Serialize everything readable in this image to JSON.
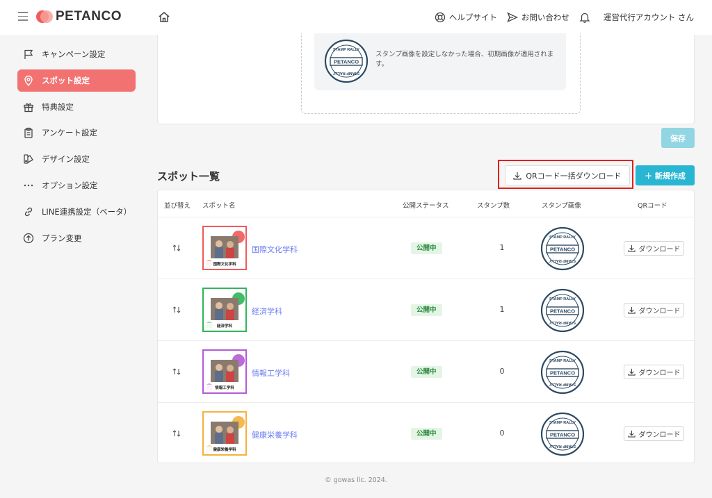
{
  "header": {
    "logo_text": "PETANCO",
    "help_label": "ヘルプサイト",
    "contact_label": "お問い合わせ",
    "account_label": "運営代行アカウント さん"
  },
  "sidebar": {
    "items": [
      {
        "label": "キャンペーン設定",
        "icon": "flag-icon",
        "active": false
      },
      {
        "label": "スポット設定",
        "icon": "map-pin-icon",
        "active": true
      },
      {
        "label": "特典設定",
        "icon": "gift-icon",
        "active": false
      },
      {
        "label": "アンケート設定",
        "icon": "clipboard-icon",
        "active": false
      },
      {
        "label": "デザイン設定",
        "icon": "palette-icon",
        "active": false
      },
      {
        "label": "オプション設定",
        "icon": "more-icon",
        "active": false
      },
      {
        "label": "LINE連携設定（ベータ）",
        "icon": "link-icon",
        "active": false
      },
      {
        "label": "プラン変更",
        "icon": "arrow-up-circle-icon",
        "active": false
      }
    ]
  },
  "stamp_image": {
    "note": "スタンプ画像を設定しなかった場合、初期画像が適用されます。",
    "stamp_text_top": "STAMP RALLY",
    "stamp_text_center": "PETANCO"
  },
  "save_label": "保存",
  "spot_list": {
    "title": "スポット一覧",
    "bulk_qr_label": "QRコード一括ダウンロード",
    "new_label": "＋ 新規作成",
    "columns": {
      "sort": "並び替え",
      "name": "スポット名",
      "status": "公開ステータス",
      "stamps": "スタンプ数",
      "stamp_image": "スタンプ画像",
      "qr": "QRコード"
    },
    "rows": [
      {
        "name": "国際文化学科",
        "status": "公開中",
        "stamps": "1",
        "download": "ダウンロード",
        "thumb_label": "国際文化学科",
        "accent": "#f05a5a"
      },
      {
        "name": "経済学科",
        "status": "公開中",
        "stamps": "1",
        "download": "ダウンロード",
        "thumb_label": "経済学科",
        "accent": "#2fb55a"
      },
      {
        "name": "情報工学科",
        "status": "公開中",
        "stamps": "0",
        "download": "ダウンロード",
        "thumb_label": "情報工学科",
        "accent": "#b55ad8"
      },
      {
        "name": "健康栄養学科",
        "status": "公開中",
        "stamps": "0",
        "download": "ダウンロード",
        "thumb_label": "健康栄養学科",
        "accent": "#f5b13d"
      }
    ]
  },
  "footer": "© gowas llc. 2024.",
  "colors": {
    "accent_active": "#f27272",
    "primary_button": "#29b6d3",
    "save_disabled": "#92d6e3",
    "highlight": "#e0201f",
    "link": "#6b7cf2",
    "stamp": "#2e4a63"
  }
}
